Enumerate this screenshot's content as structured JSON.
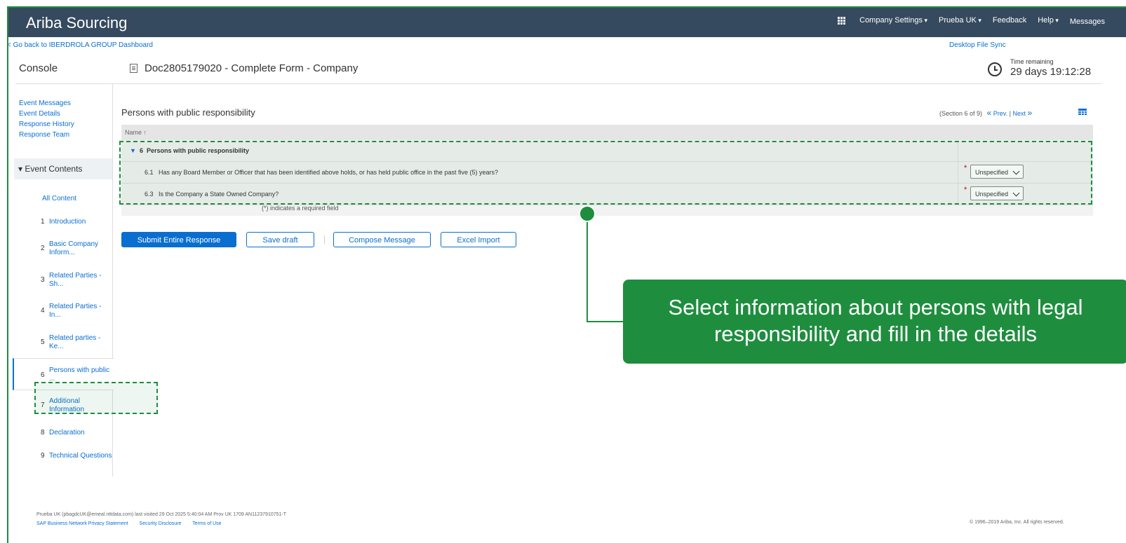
{
  "header": {
    "brand": "Ariba Sourcing",
    "nav": [
      "Company Settings",
      "Prueba UK",
      "Feedback",
      "Help",
      "Messages"
    ]
  },
  "subbar": {
    "back": "< Go back to IBERDROLA GROUP Dashboard",
    "sync": "Desktop File Sync"
  },
  "console": "Console",
  "doc_title": "Doc2805179020 - Complete Form - Company",
  "timer": {
    "label": "Time remaining",
    "value": "29 days 19:12:28"
  },
  "sidebar": {
    "links": [
      "Event Messages",
      "Event Details",
      "Response History",
      "Response Team"
    ],
    "event_contents": "Event Contents",
    "all_content": "All Content",
    "items": [
      {
        "num": "1",
        "label": "Introduction"
      },
      {
        "num": "2",
        "label": "Basic Company Inform..."
      },
      {
        "num": "3",
        "label": "Related Parties - Sh..."
      },
      {
        "num": "4",
        "label": "Related Parties - In..."
      },
      {
        "num": "5",
        "label": "Related parties - Ke..."
      },
      {
        "num": "6",
        "label": "Persons with public ..."
      },
      {
        "num": "7",
        "label": "Additional Information"
      },
      {
        "num": "8",
        "label": "Declaration"
      },
      {
        "num": "9",
        "label": "Technical Questions"
      }
    ]
  },
  "section": {
    "title": "Persons with public responsibility",
    "counter": "(Section 6 of 9)",
    "prev": "Prev.",
    "next": "Next"
  },
  "table": {
    "header": "Name ↑",
    "group": {
      "num": "6",
      "label": "Persons with public responsibility"
    },
    "rows": [
      {
        "num": "6.1",
        "question": "Has any Board Member or Officer that has been identified above holds, or has held public office in the past five (5) years?",
        "value": "Unspecified"
      },
      {
        "num": "6.3",
        "question": "Is the Company a State Owned Company?",
        "value": "Unspecified"
      }
    ],
    "required_note": "(*) indicates a required field"
  },
  "buttons": {
    "submit": "Submit Entire Response",
    "save": "Save draft",
    "compose": "Compose Message",
    "excel": "Excel Import"
  },
  "callout": {
    "line1": "Select information about persons with legal",
    "line2": "responsibility and fill in the details"
  },
  "footer": {
    "visit": "Prueba UK (pbagdcUK@emeal.nttdata.com) last visited 29 Oct 2025 5:40:04 AM   Prov UK 1709  AN11237910751-T",
    "links": [
      "SAP Business Network Privacy Statement",
      "Security Disclosure",
      "Terms of Use"
    ],
    "copyright": "© 1996–2019 Ariba, Inc. All rights reserved."
  },
  "colors": {
    "header": "#354a5f",
    "link": "#0a6ed1",
    "callout": "#1e8e3e"
  }
}
